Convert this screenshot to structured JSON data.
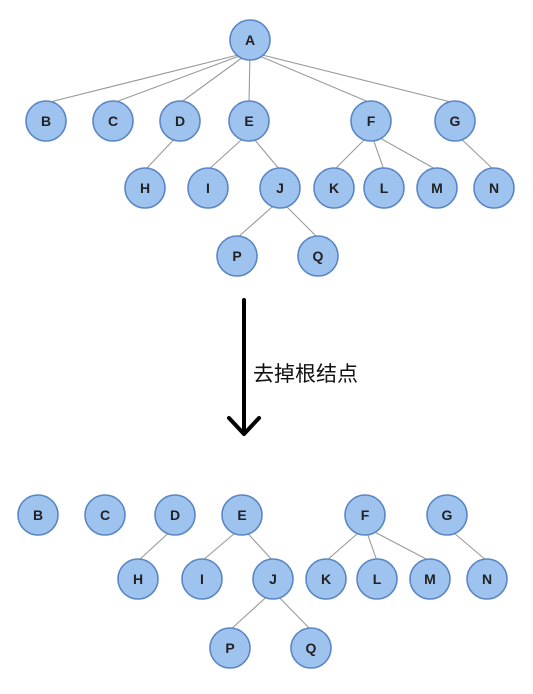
{
  "diagram": {
    "operation_label": "去掉根结点",
    "before_tree": {
      "nodes": [
        "A",
        "B",
        "C",
        "D",
        "E",
        "F",
        "G",
        "H",
        "I",
        "J",
        "K",
        "L",
        "M",
        "N",
        "P",
        "Q"
      ],
      "edges": [
        [
          "A",
          "B"
        ],
        [
          "A",
          "C"
        ],
        [
          "A",
          "D"
        ],
        [
          "A",
          "E"
        ],
        [
          "A",
          "F"
        ],
        [
          "A",
          "G"
        ],
        [
          "D",
          "H"
        ],
        [
          "E",
          "I"
        ],
        [
          "E",
          "J"
        ],
        [
          "F",
          "K"
        ],
        [
          "F",
          "L"
        ],
        [
          "F",
          "M"
        ],
        [
          "G",
          "N"
        ],
        [
          "J",
          "P"
        ],
        [
          "J",
          "Q"
        ]
      ]
    },
    "after_forest": {
      "nodes": [
        "B",
        "C",
        "D",
        "E",
        "F",
        "G",
        "H",
        "I",
        "J",
        "K",
        "L",
        "M",
        "N",
        "P",
        "Q"
      ],
      "edges": [
        [
          "D",
          "H"
        ],
        [
          "E",
          "I"
        ],
        [
          "E",
          "J"
        ],
        [
          "F",
          "K"
        ],
        [
          "F",
          "L"
        ],
        [
          "F",
          "M"
        ],
        [
          "G",
          "N"
        ],
        [
          "J",
          "P"
        ],
        [
          "J",
          "Q"
        ]
      ]
    }
  }
}
